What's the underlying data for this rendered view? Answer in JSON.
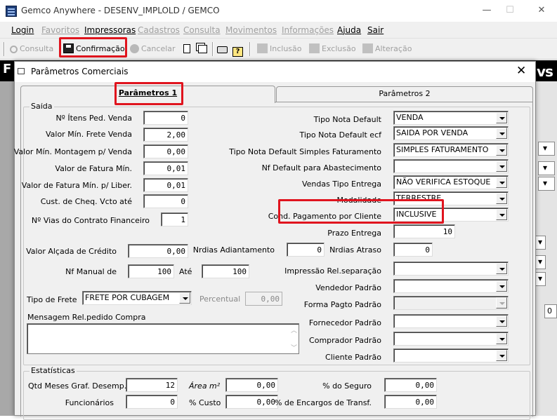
{
  "window": {
    "title": "Gemco Anywhere - DESENV_IMPLOLD / GEMCO"
  },
  "menu": [
    {
      "label": "Login",
      "enabled": true
    },
    {
      "label": "Favoritos",
      "enabled": false
    },
    {
      "label": "Impressoras",
      "enabled": true
    },
    {
      "label": "Cadastros",
      "enabled": false
    },
    {
      "label": "Consulta",
      "enabled": false
    },
    {
      "label": "Movimentos",
      "enabled": false
    },
    {
      "label": "Informações",
      "enabled": false
    },
    {
      "label": "Ajuda",
      "enabled": true
    },
    {
      "label": "Sair",
      "enabled": true
    }
  ],
  "toolbar": {
    "consulta": "Consulta",
    "confirmacao": "Confirmação",
    "cancelar": "Cancelar",
    "inclusao": "Inclusão",
    "exclusao": "Exclusão",
    "alteracao": "Alteração"
  },
  "background": {
    "left_text": "F",
    "right_text": "vs",
    "field_value": "0"
  },
  "dialog": {
    "title": "Parâmetros Comerciais",
    "tabs": [
      "Parâmetros 1",
      "Parâmetros 2"
    ],
    "saida": {
      "group_label": "Saída",
      "fields": [
        {
          "label": "Nº Ítens Ped. Venda",
          "value": "0"
        },
        {
          "label": "Valor Mín. Frete Venda",
          "value": "2,00"
        },
        {
          "label": "Valor Mín. Montagem p/ Venda",
          "value": "0,00"
        },
        {
          "label": "Valor de Fatura Mín.",
          "value": "0,01"
        },
        {
          "label": "Valor de Fatura Mín. p/ Liber.",
          "value": "0,01"
        },
        {
          "label": "Cust. de Cheq. Vcto até",
          "value": "0"
        }
      ],
      "vias_label": "Nº Vias do Contrato Financeiro",
      "vias_value": "1",
      "right_fields": [
        {
          "label": "Tipo Nota Default",
          "value": "VENDA"
        },
        {
          "label": "Tipo Nota Default ecf",
          "value": "SAIDA POR VENDA"
        },
        {
          "label": "Tipo Nota Default Simples Faturamento",
          "value": "SIMPLES FATURAMENTO"
        },
        {
          "label": "Nf Default para Abastecimento",
          "value": ""
        },
        {
          "label": "Vendas Tipo Entrega",
          "value": "NÃO VERIFICA ESTOQUE"
        },
        {
          "label": "Modalidade",
          "value": "TERRESTRE"
        },
        {
          "label": "Cond. Pagamento por Cliente",
          "value": "INCLUSIVE"
        }
      ],
      "prazo_label": "Prazo Entrega",
      "prazo_value": "10",
      "alcada_label": "Valor Alçada de Crédito",
      "alcada_value": "0,00",
      "adiantamento_label": "Nrdias Adiantamento",
      "adiantamento_value": "0",
      "atraso_label": "Nrdias Atraso",
      "atraso_value": "0",
      "nf_manual_label": "Nf Manual de",
      "nf_manual_from": "100",
      "ate_label": "Até",
      "nf_manual_to": "100",
      "impressao_label": "Impressão Rel.separação",
      "tipo_frete_label": "Tipo de Frete",
      "tipo_frete_value": "FRETE POR CUBAGEM",
      "percentual_label": "Percentual",
      "percentual_value": "0,00",
      "mensagem_label": "Mensagem Rel.pedido Compra",
      "lower_right": [
        {
          "label": "Vendedor Padrão",
          "value": ""
        },
        {
          "label": "Forma Pagto Padrão",
          "value": ""
        },
        {
          "label": "Fornecedor Padrão",
          "value": ""
        },
        {
          "label": "Comprador Padrão",
          "value": ""
        },
        {
          "label": "Cliente Padrão",
          "value": ""
        }
      ]
    },
    "estatisticas": {
      "group_label": "Estatísticas",
      "qtd_meses_label": "Qtd Meses Graf. Desemp.",
      "qtd_meses_value": "12",
      "area_label": "Área m²",
      "area_value": "0,00",
      "seguro_label": "% do Seguro",
      "seguro_value": "0,00",
      "funcionarios_label": "Funcionários",
      "funcionarios_value": "0",
      "custo_label": "% Custo",
      "custo_value": "0,00",
      "encargos_label": "% de Encargos de Transf.",
      "encargos_value": "0,00"
    }
  }
}
